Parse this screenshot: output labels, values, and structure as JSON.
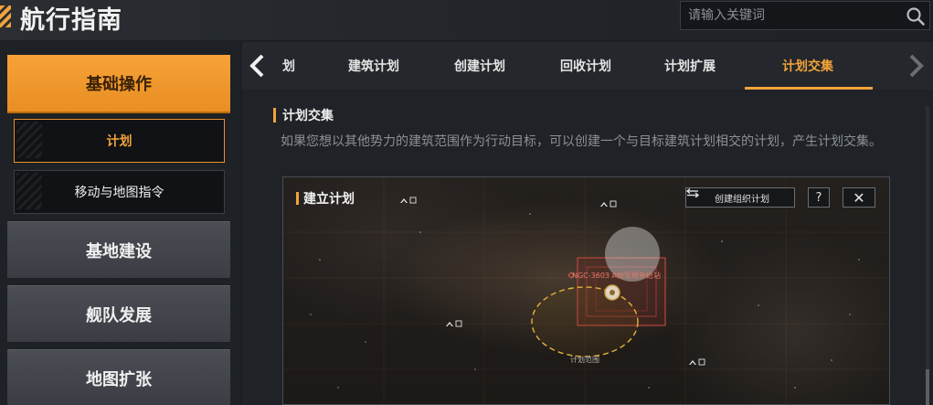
{
  "header": {
    "title": "航行指南",
    "search_placeholder": "请输入关键词"
  },
  "sidebar": {
    "primary": "基础操作",
    "subitems": [
      {
        "label": "计划",
        "active": true
      },
      {
        "label": "移动与地图指令",
        "active": false
      }
    ],
    "categories": [
      "基地建设",
      "舰队发展",
      "地图扩张"
    ]
  },
  "tabs": {
    "items": [
      "划",
      "建筑计划",
      "创建计划",
      "回收计划",
      "计划扩展",
      "计划交集"
    ],
    "active_index": 5
  },
  "section": {
    "title": "计划交集",
    "description": "如果您想以其他势力的建筑范围作为行动目标，可以创建一个与目标建筑计划相交的计划，产生计划交集。"
  },
  "map": {
    "title": "建立计划",
    "create_button": "创建组织计划",
    "help_button": "?",
    "close_button": "✕",
    "station_label": "NGC-3603 A标军用补给站",
    "range_label": "计划范围"
  },
  "colors": {
    "accent": "#f2a33a",
    "range_circle": "#e6b33a",
    "station": "#d9574b"
  },
  "icons": [
    "search-icon",
    "chevron-left-icon",
    "chevron-right-icon",
    "swap-icon",
    "help-icon",
    "close-icon",
    "fleet-marker-icon"
  ]
}
